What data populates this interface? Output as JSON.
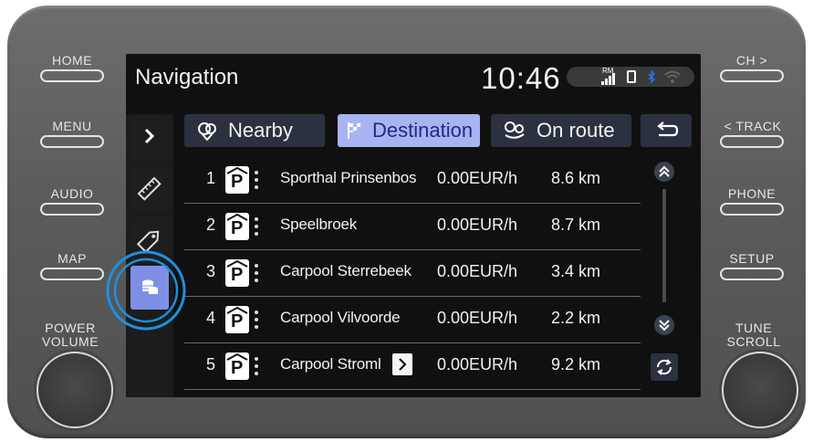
{
  "hardware": {
    "left": [
      "HOME",
      "MENU",
      "AUDIO",
      "MAP"
    ],
    "left_knob": "POWER VOLUME",
    "right": [
      "CH >",
      "< TRACK",
      "PHONE",
      "SETUP"
    ],
    "right_knob": "TUNE SCROLL"
  },
  "header": {
    "title": "Navigation",
    "clock": "10:46",
    "rm_label": "RM"
  },
  "tabs": [
    {
      "label": "Nearby",
      "icon": "pin-search-icon",
      "active": false
    },
    {
      "label": "Destination",
      "icon": "checkered-flag-icon",
      "active": true
    },
    {
      "label": "On route",
      "icon": "route-pins-icon",
      "active": false
    }
  ],
  "rows": [
    {
      "num": "1",
      "name": "Sporthal Prinsenbos",
      "price": "0.00EUR/h",
      "dist": "8.6 km"
    },
    {
      "num": "2",
      "name": "Speelbroek",
      "price": "0.00EUR/h",
      "dist": "8.7 km"
    },
    {
      "num": "3",
      "name": "Carpool Sterrebeek",
      "price": "0.00EUR/h",
      "dist": "3.4 km"
    },
    {
      "num": "4",
      "name": "Carpool Vilvoorde",
      "price": "0.00EUR/h",
      "dist": "2.2 km"
    },
    {
      "num": "5",
      "name": "Carpool Stroml",
      "price": "0.00EUR/h",
      "dist": "9.2 km"
    }
  ],
  "colors": {
    "active_tab_bg": "#a8b4f2",
    "active_tab_text": "#1f2a8a",
    "highlight_ring": "#1e8fe0",
    "selected_rail_bg": "#7f8fe6"
  }
}
